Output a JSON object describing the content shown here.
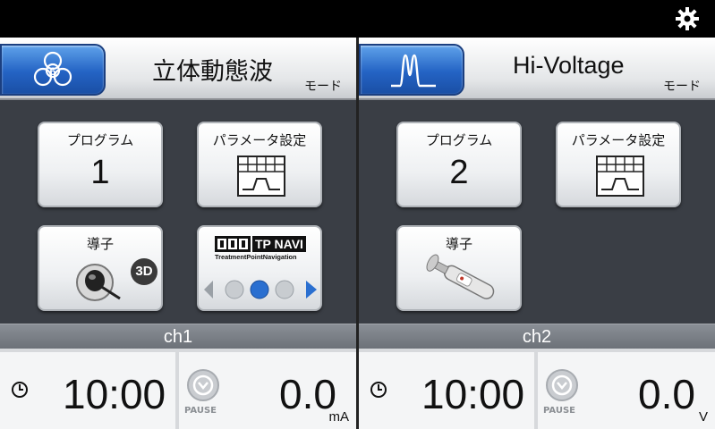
{
  "icons": {
    "settings": "gear-icon",
    "mode_ch1": "stereo-dynamic-wave-icon",
    "mode_ch2": "hi-voltage-waveform-icon",
    "param": "parameter-grid-icon",
    "probe_ch1": "3d-probe-icon",
    "probe_ch2": "handheld-probe-icon",
    "timer": "clock-icon",
    "pause": "pause-icon"
  },
  "colors": {
    "accent_blue": "#2463c4",
    "panel_bg": "#3a3e45"
  },
  "channels": [
    {
      "mode_title": "立体動態波",
      "mode_sub": "モード",
      "program_label": "プログラム",
      "program_value": "1",
      "param_label": "パラメータ設定",
      "probe_label": "導子",
      "probe_badge": "3D",
      "tpnavi": {
        "title": "TP NAVI",
        "subtitle": "TreatmentPointNavigation"
      },
      "channel_name": "ch1",
      "time": "10:00",
      "pause_label": "PAUSE",
      "output_value": "0.0",
      "output_unit": "mA"
    },
    {
      "mode_title": "Hi-Voltage",
      "mode_sub": "モード",
      "program_label": "プログラム",
      "program_value": "2",
      "param_label": "パラメータ設定",
      "probe_label": "導子",
      "channel_name": "ch2",
      "time": "10:00",
      "pause_label": "PAUSE",
      "output_value": "0.0",
      "output_unit": "V"
    }
  ]
}
